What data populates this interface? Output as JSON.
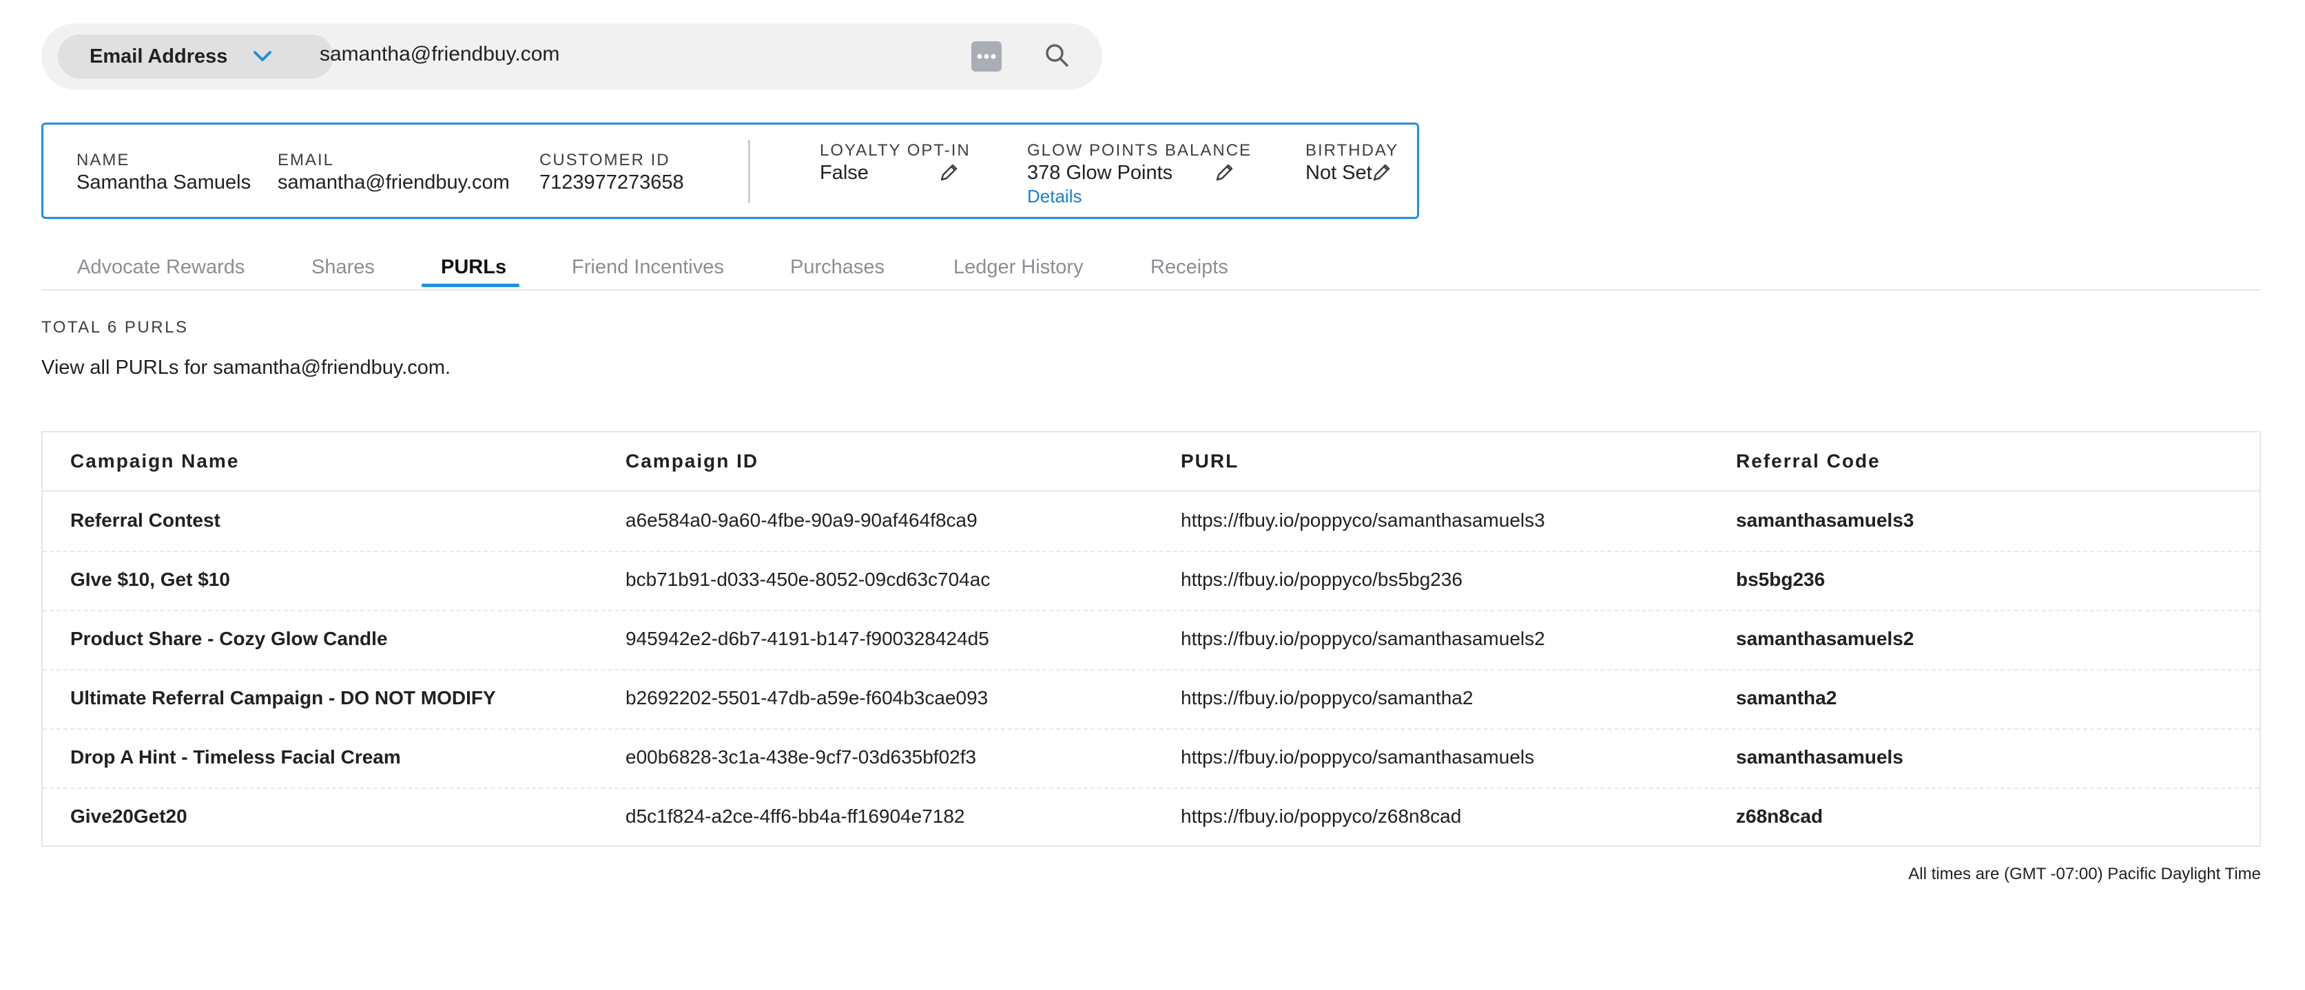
{
  "search": {
    "field_label": "Email Address",
    "query": "samantha@friendbuy.com"
  },
  "customer": {
    "name_caption": "NAME",
    "name": "Samantha Samuels",
    "email_caption": "EMAIL",
    "email": "samantha@friendbuy.com",
    "id_caption": "CUSTOMER ID",
    "id": "7123977273658",
    "loyalty_caption": "LOYALTY OPT-IN",
    "loyalty": "False",
    "points_caption": "GLOW POINTS BALANCE",
    "points": "378 Glow Points",
    "points_details": "Details",
    "birthday_caption": "BIRTHDAY",
    "birthday": "Not Set"
  },
  "tabs": [
    {
      "label": "Advocate Rewards"
    },
    {
      "label": "Shares"
    },
    {
      "label": "PURLs"
    },
    {
      "label": "Friend Incentives"
    },
    {
      "label": "Purchases"
    },
    {
      "label": "Ledger History"
    },
    {
      "label": "Receipts"
    }
  ],
  "active_tab": "PURLs",
  "summary": {
    "total": "TOTAL 6 PURLS",
    "description": "View all PURLs for samantha@friendbuy.com."
  },
  "table": {
    "headers": [
      "Campaign Name",
      "Campaign ID",
      "PURL",
      "Referral Code"
    ],
    "rows": [
      [
        "Referral Contest",
        "a6e584a0-9a60-4fbe-90a9-90af464f8ca9",
        "https://fbuy.io/poppyco/samanthasamuels3",
        "samanthasamuels3"
      ],
      [
        "GIve $10, Get $10",
        "bcb71b91-d033-450e-8052-09cd63c704ac",
        "https://fbuy.io/poppyco/bs5bg236",
        "bs5bg236"
      ],
      [
        "Product Share - Cozy Glow Candle",
        "945942e2-d6b7-4191-b147-f900328424d5",
        "https://fbuy.io/poppyco/samanthasamuels2",
        "samanthasamuels2"
      ],
      [
        "Ultimate Referral Campaign - DO NOT MODIFY",
        "b2692202-5501-47db-a59e-f604b3cae093",
        "https://fbuy.io/poppyco/samantha2",
        "samantha2"
      ],
      [
        "Drop A Hint - Timeless Facial Cream",
        "e00b6828-3c1a-438e-9cf7-03d635bf02f3",
        "https://fbuy.io/poppyco/samanthasamuels",
        "samanthasamuels"
      ],
      [
        "Give20Get20",
        "d5c1f824-a2ce-4ff6-bb4a-ff16904e7182",
        "https://fbuy.io/poppyco/z68n8cad",
        "z68n8cad"
      ]
    ]
  },
  "footnote": "All times are (GMT -07:00) Pacific Daylight Time",
  "colors": {
    "accent": "#1e90e8",
    "link": "#1a7fd8"
  },
  "icons": [
    "chevron-down-icon",
    "more-icon",
    "search-icon",
    "pencil-icon"
  ]
}
